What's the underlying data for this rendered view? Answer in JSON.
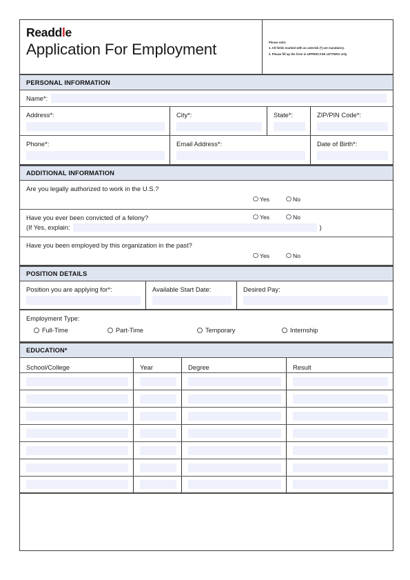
{
  "header": {
    "logo_text_1": "Readd",
    "logo_accent": "l",
    "logo_text_2": "e",
    "title": "Application For Employment",
    "note_title": "Please note:",
    "note_1": "1. All fields marked with an asterisk (*) are mandatory.",
    "note_2": "2. Please fill up the form in UPPERCASE LETTERS only."
  },
  "colors": {
    "band": "#dee5f1",
    "field": "#eef0fb",
    "accent": "#d0202a",
    "border": "#4a4a4a"
  },
  "personal": {
    "band": "PERSONAL INFORMATION",
    "name_label": "Name*:",
    "address_label": "Address*:",
    "city_label": "City*:",
    "state_label": "State*:",
    "zip_label": "ZIP/PIN Code*:",
    "phone_label": "Phone*:",
    "email_label": "Email Address*:",
    "dob_label": "Date of Birth*:"
  },
  "additional": {
    "band": "ADDITIONAL INFORMATION",
    "q1": "Are you legally authorized to work in the U.S.?",
    "q2": "Have you ever been convicted of a felony?",
    "q2_explain_label": "(If Yes, explain:",
    "q2_explain_close": ")",
    "q3": "Have you been employed by this organization in the past?",
    "yes": "Yes",
    "no": "No"
  },
  "position": {
    "band": "POSITION DETAILS",
    "position_label": "Position you are applying for*:",
    "start_label": "Available Start Date:",
    "pay_label": "Desired Pay:",
    "employment_type_label": "Employment Type:",
    "types": [
      "Full-Time",
      "Part-Time",
      "Temporary",
      "Internship"
    ]
  },
  "education": {
    "band": "EDUCATION*",
    "columns": [
      "School/College",
      "Year",
      "Degree",
      "Result"
    ],
    "rows": [
      [
        "",
        "",
        "",
        ""
      ],
      [
        "",
        "",
        "",
        ""
      ],
      [
        "",
        "",
        "",
        ""
      ],
      [
        "",
        "",
        "",
        ""
      ],
      [
        "",
        "",
        "",
        ""
      ],
      [
        "",
        "",
        "",
        ""
      ],
      [
        "",
        "",
        "",
        ""
      ]
    ]
  }
}
